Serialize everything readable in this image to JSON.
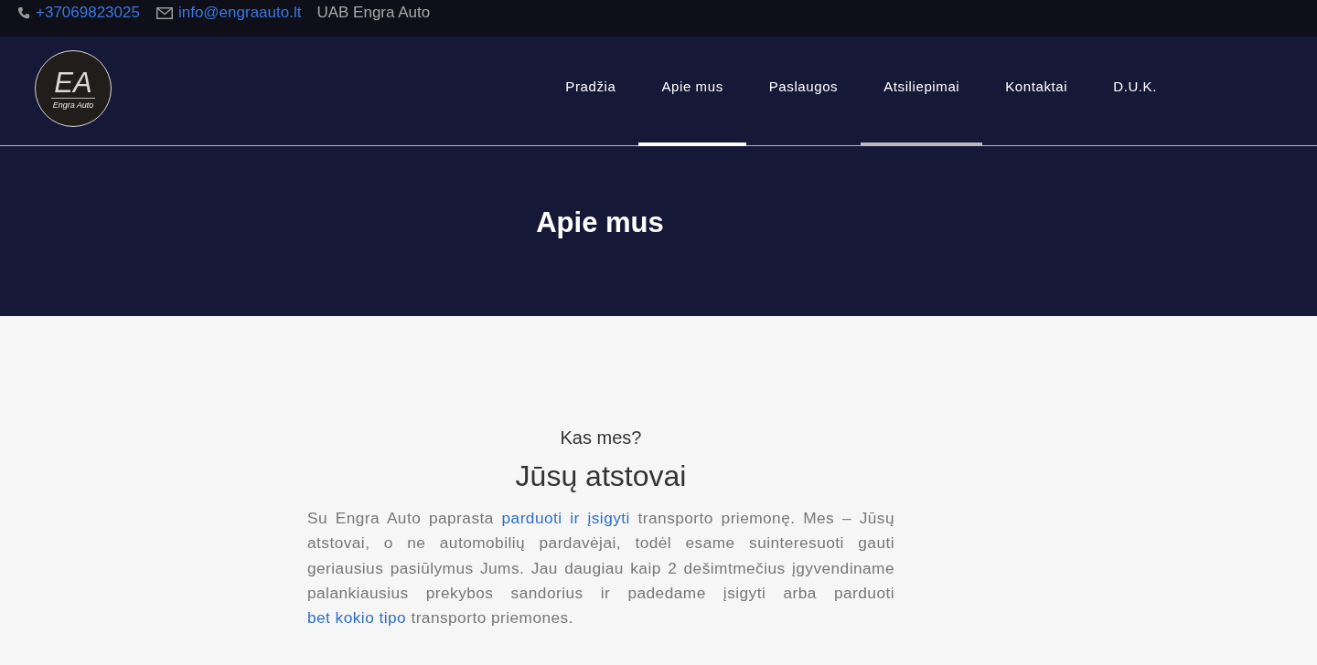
{
  "top_bar": {
    "phone": "+37069823025",
    "email": "info@engraauto.lt",
    "company": "UAB Engra Auto"
  },
  "logo": {
    "initials": "EA",
    "name": "Engra Auto"
  },
  "nav": [
    {
      "label": "Pradžia",
      "selected": false,
      "hovered": false
    },
    {
      "label": "Apie mus",
      "selected": true,
      "hovered": false
    },
    {
      "label": "Paslaugos",
      "selected": false,
      "hovered": false
    },
    {
      "label": "Atsiliepimai",
      "selected": false,
      "hovered": true
    },
    {
      "label": "Kontaktai",
      "selected": false,
      "hovered": false
    },
    {
      "label": "D.U.K.",
      "selected": false,
      "hovered": false
    }
  ],
  "hero": {
    "title": "Apie mus"
  },
  "section": {
    "kicker": "Kas mes?",
    "heading": "Jūsų atstovai",
    "paragraph": [
      {
        "text": "Su Engra Auto paprasta ",
        "link": false
      },
      {
        "text": "parduoti ir įsigyti",
        "link": true
      },
      {
        "text": " transporto priemonę. Mes – Jūsų atstovai, o ne automobilių pardavėjai, todėl esame suinteresuoti gauti geriausius pasiūlymus Jums. Jau daugiau kaip 2 dešimtmečius įgyvendiname palankiausius prekybos sandorius ir padedame įsigyti arba parduoti ",
        "link": false
      },
      {
        "text": "bet kokio tipo",
        "link": true
      },
      {
        "text": " transporto priemones.",
        "link": false
      }
    ]
  }
}
